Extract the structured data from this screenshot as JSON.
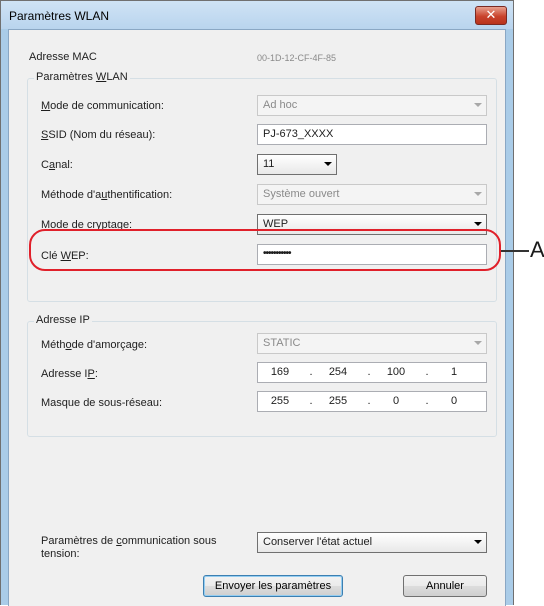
{
  "window": {
    "title": "Paramètres WLAN",
    "close_symbol": "✕"
  },
  "mac": {
    "label": "Adresse MAC",
    "value": "00-1D-12-CF-4F-85"
  },
  "wlan_group": {
    "title": "Paramètres WLAN",
    "mode": {
      "label": "Mode de communication:",
      "value": "Ad hoc"
    },
    "ssid": {
      "label": "SSID (Nom du réseau):",
      "value": "PJ-673_XXXX"
    },
    "canal": {
      "label": "Canal:",
      "value": "11"
    },
    "auth": {
      "label": "Méthode d'authentification:",
      "value": "Système ouvert"
    },
    "crypt": {
      "label": "Mode de cryptage:",
      "value": "WEP"
    },
    "wep": {
      "label": "Clé WEP:",
      "value": "•••••••••••"
    }
  },
  "ip_group": {
    "title": "Adresse IP",
    "boot": {
      "label": "Méthode d'amorçage:",
      "value": "STATIC"
    },
    "ip": {
      "label": "Adresse IP:",
      "octets": [
        "169",
        "254",
        "100",
        "1"
      ]
    },
    "mask": {
      "label": "Masque de sous-réseau:",
      "octets": [
        "255",
        "255",
        "0",
        "0"
      ]
    }
  },
  "power_on": {
    "label": "Paramètres de communication sous tension:",
    "value": "Conserver l'état actuel"
  },
  "buttons": {
    "send": "Envoyer les paramètres",
    "cancel": "Annuler"
  },
  "callout": {
    "letter": "A"
  },
  "colors": {
    "highlight": "#e0202a",
    "close_button": "#c9432c"
  }
}
